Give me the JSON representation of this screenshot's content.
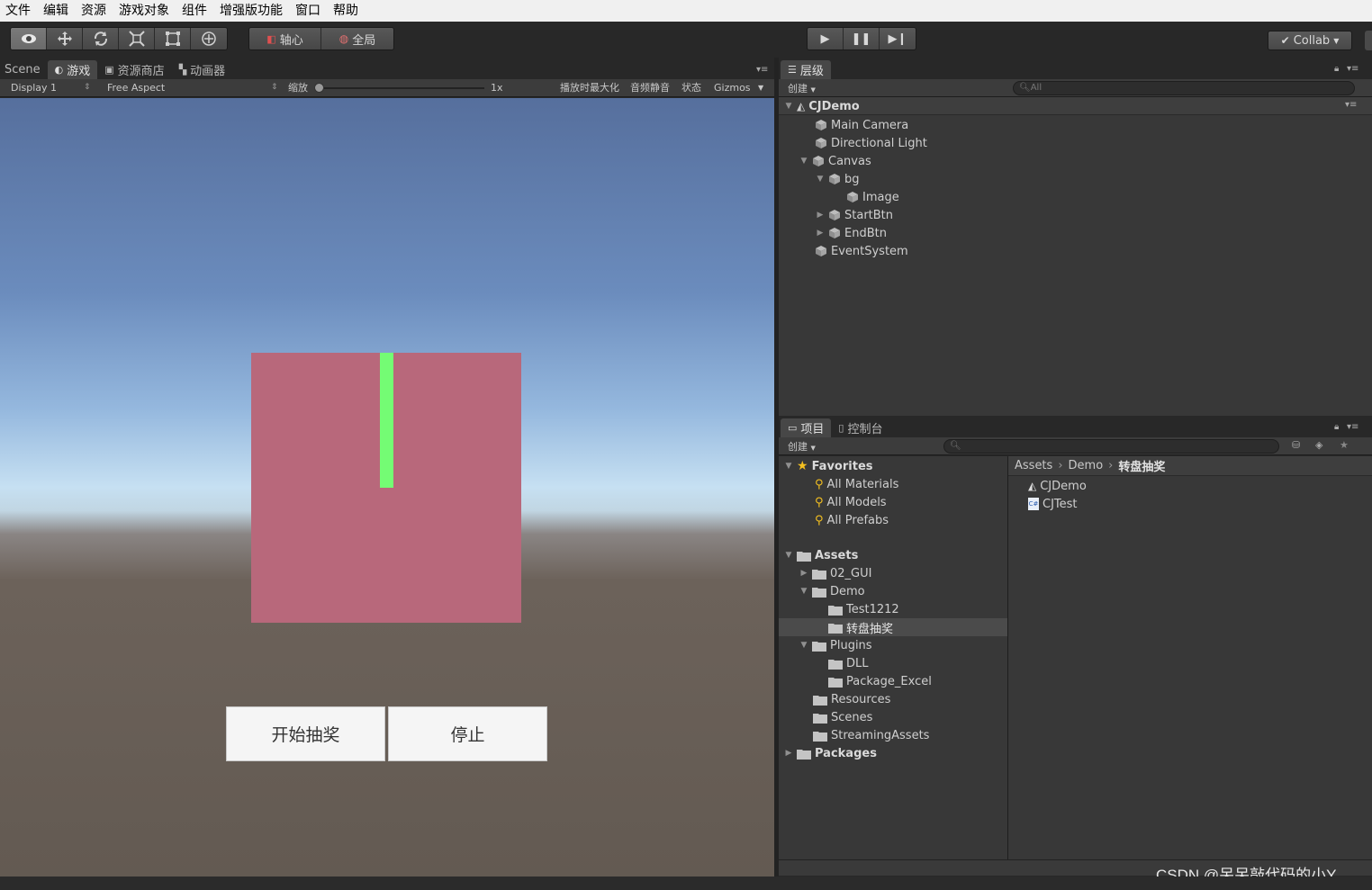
{
  "menu": [
    "文件",
    "编辑",
    "资源",
    "游戏对象",
    "组件",
    "增强版功能",
    "窗口",
    "帮助"
  ],
  "toolbar": {
    "tools": [
      "hand-tool",
      "move-tool",
      "rotate-tool",
      "scale-tool",
      "rect-tool",
      "transform-tool"
    ],
    "pivot_label": "轴心",
    "global_label": "全局",
    "collab_label": "Collab"
  },
  "game_panel": {
    "tabs": [
      "Scene",
      "游戏",
      "资源商店",
      "动画器"
    ],
    "display": "Display 1",
    "aspect": "Free Aspect",
    "scale_label": "缩放",
    "scale_value": "1x",
    "maximize": "播放时最大化",
    "mute": "音频静音",
    "stats": "状态",
    "gizmos": "Gizmos",
    "buttons": {
      "start": "开始抽奖",
      "stop": "停止"
    }
  },
  "hierarchy": {
    "tab": "层级",
    "create": "创建",
    "search_placeholder": "All",
    "root": "CJDemo",
    "items": [
      "Main Camera",
      "Directional Light",
      "Canvas",
      "bg",
      "Image",
      "StartBtn",
      "EndBtn",
      "EventSystem"
    ]
  },
  "project": {
    "tabs": [
      "项目",
      "控制台"
    ],
    "create": "创建",
    "favorites": {
      "title": "Favorites",
      "items": [
        "All Materials",
        "All Models",
        "All Prefabs"
      ]
    },
    "assets": {
      "title": "Assets",
      "items": [
        "02_GUI",
        "Demo",
        "Test1212",
        "转盘抽奖",
        "Plugins",
        "DLL",
        "Package_Excel",
        "Resources",
        "Scenes",
        "StreamingAssets"
      ]
    },
    "packages": "Packages",
    "breadcrumb": [
      "Assets",
      "Demo",
      "转盘抽奖"
    ],
    "files": [
      "CJDemo",
      "CJTest"
    ]
  },
  "watermark": "CSDN @呆呆敲代码的小Y"
}
